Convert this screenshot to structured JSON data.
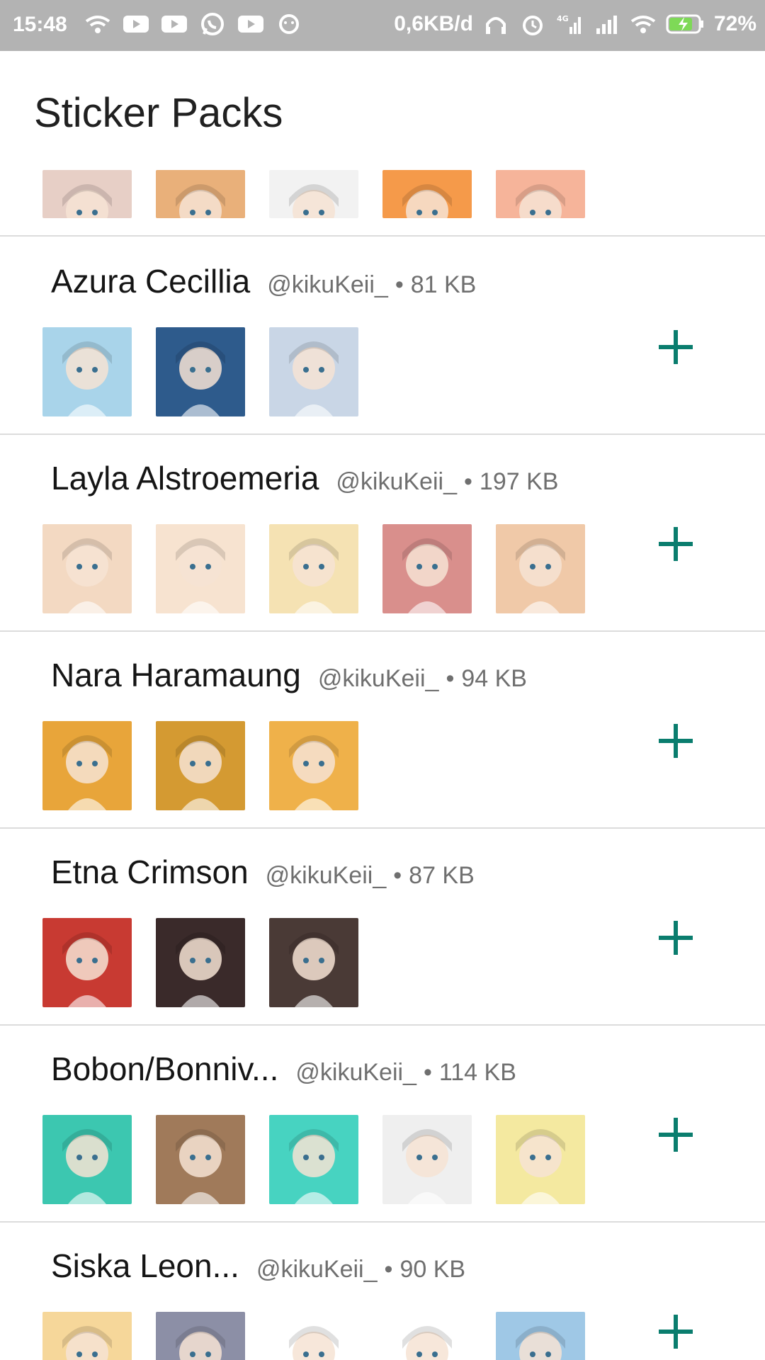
{
  "status_bar": {
    "time": "15:48",
    "network_speed": "0,6KB/d",
    "battery": "72%",
    "icons_left": [
      "wifi-calling-icon",
      "youtube-icon",
      "youtube-icon",
      "whatsapp-icon",
      "youtube-icon",
      "app-icon"
    ],
    "icons_right": [
      "headset-icon",
      "alarm-icon",
      "signal-4g-icon",
      "signal-icon",
      "wifi-icon",
      "battery-charging-icon"
    ]
  },
  "app_bar": {
    "title": "Sticker Packs"
  },
  "colors": {
    "accent": "#0a7d6e",
    "divider": "#dcdcdc",
    "meta_text": "#6f6f6f"
  },
  "packs": [
    {
      "name": "Azura Cecillia",
      "author": "@kikuKeii_",
      "size": "81 KB",
      "thumb_colors": [
        "#a9d4ea",
        "#2e5b8c",
        "#c9d6e6"
      ]
    },
    {
      "name": "Layla Alstroemeria",
      "author": "@kikuKeii_",
      "size": "197 KB",
      "thumb_colors": [
        "#f3d9c2",
        "#f7e3d0",
        "#f5e2b3",
        "#d98f8c",
        "#f0c9a8"
      ]
    },
    {
      "name": "Nara Haramaung",
      "author": "@kikuKeii_",
      "size": "94 KB",
      "thumb_colors": [
        "#e8a53a",
        "#d49a32",
        "#efb14a"
      ]
    },
    {
      "name": "Etna Crimson",
      "author": "@kikuKeii_",
      "size": "87 KB",
      "thumb_colors": [
        "#c83a32",
        "#3a2a2a",
        "#4a3a36"
      ]
    },
    {
      "name": "Bobon/Bonniv...",
      "author": "@kikuKeii_",
      "size": "114 KB",
      "thumb_colors": [
        "#3cc7b0",
        "#a07a5a",
        "#47d3c1",
        "#efefef",
        "#f4e9a0"
      ]
    },
    {
      "name": "Siska Leon...",
      "author": "@kikuKeii_",
      "size": "90 KB",
      "thumb_colors": [
        "#f6d79a",
        "#8c8fa6",
        "#ffffff",
        "#ffffff",
        "#9fc8e6"
      ]
    }
  ],
  "partial_row_thumb_colors": [
    "#e7cfc6",
    "#e9b07a",
    "#f2f2f2",
    "#f59a4a",
    "#f6b49a"
  ]
}
